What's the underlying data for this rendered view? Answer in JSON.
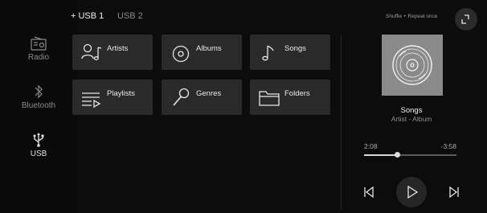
{
  "sidebar": {
    "items": [
      {
        "label": "Radio",
        "icon": "radio-icon",
        "active": false
      },
      {
        "label": "Bluetooth",
        "icon": "bluetooth-icon",
        "active": false
      },
      {
        "label": "USB",
        "icon": "usb-icon",
        "active": true
      }
    ]
  },
  "tabs": [
    {
      "label": "+ USB 1",
      "active": true
    },
    {
      "label": "USB 2",
      "active": false
    }
  ],
  "categories": [
    {
      "label": "Artists",
      "icon": "artist-icon"
    },
    {
      "label": "Albums",
      "icon": "album-icon"
    },
    {
      "label": "Songs",
      "icon": "music-note-icon"
    },
    {
      "label": "Playlists",
      "icon": "playlist-icon"
    },
    {
      "label": "Genres",
      "icon": "microphone-icon"
    },
    {
      "label": "Folders",
      "icon": "folder-icon"
    }
  ],
  "now_playing": {
    "mode": "Shuffle + Repeat once",
    "title": "Songs",
    "subtitle": "Artist - Album",
    "elapsed": "2:08",
    "remaining": "-3:58",
    "progress": 0.36
  },
  "colors": {
    "background": "#0c0c0c",
    "tile": "#2a2a2a",
    "album_art": "#8a8a8a",
    "text": "#e6e6e6",
    "muted": "#8a8a8a"
  }
}
